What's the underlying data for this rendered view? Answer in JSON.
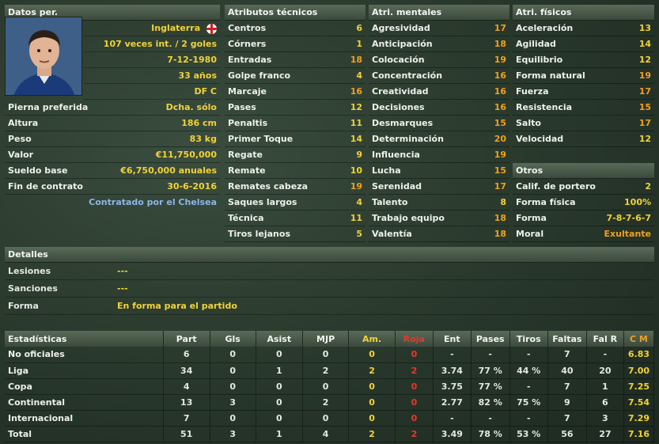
{
  "personal": {
    "header": "Datos per.",
    "nationality": "Inglaterra",
    "caps": "107 veces int. / 2 goles",
    "dob": "7-12-1980",
    "age": "33 años",
    "position": "DF C",
    "rows": [
      {
        "label": "Pierna preferida",
        "value": "Dcha. sólo"
      },
      {
        "label": "Altura",
        "value": "186 cm"
      },
      {
        "label": "Peso",
        "value": "83 kg"
      },
      {
        "label": "Valor",
        "value": "€11,750,000"
      },
      {
        "label": "Sueldo base",
        "value": "€6,750,000 anuales"
      },
      {
        "label": "Fin de contrato",
        "value": "30-6-2016"
      }
    ],
    "contract_note": "Contratado por el Chelsea"
  },
  "technical": {
    "header": "Atributos técnicos",
    "rows": [
      {
        "label": "Centros",
        "value": "6"
      },
      {
        "label": "Córners",
        "value": "1"
      },
      {
        "label": "Entradas",
        "value": "18"
      },
      {
        "label": "Golpe franco",
        "value": "4"
      },
      {
        "label": "Marcaje",
        "value": "16"
      },
      {
        "label": "Pases",
        "value": "12"
      },
      {
        "label": "Penaltis",
        "value": "11"
      },
      {
        "label": "Primer Toque",
        "value": "14"
      },
      {
        "label": "Regate",
        "value": "9"
      },
      {
        "label": "Remate",
        "value": "10"
      },
      {
        "label": "Remates cabeza",
        "value": "19"
      },
      {
        "label": "Saques largos",
        "value": "4"
      },
      {
        "label": "Técnica",
        "value": "11"
      },
      {
        "label": "Tiros lejanos",
        "value": "5"
      }
    ]
  },
  "mental": {
    "header": "Atri. mentales",
    "rows": [
      {
        "label": "Agresividad",
        "value": "17"
      },
      {
        "label": "Anticipación",
        "value": "18"
      },
      {
        "label": "Colocación",
        "value": "19"
      },
      {
        "label": "Concentración",
        "value": "16"
      },
      {
        "label": "Creatividad",
        "value": "16"
      },
      {
        "label": "Decisiones",
        "value": "16"
      },
      {
        "label": "Desmarques",
        "value": "15"
      },
      {
        "label": "Determinación",
        "value": "20"
      },
      {
        "label": "Influencia",
        "value": "19"
      },
      {
        "label": "Lucha",
        "value": "15"
      },
      {
        "label": "Serenidad",
        "value": "17"
      },
      {
        "label": "Talento",
        "value": "8"
      },
      {
        "label": "Trabajo equipo",
        "value": "18"
      },
      {
        "label": "Valentía",
        "value": "18"
      }
    ]
  },
  "physical": {
    "header": "Atri. físicos",
    "rows": [
      {
        "label": "Aceleración",
        "value": "13"
      },
      {
        "label": "Agilidad",
        "value": "14"
      },
      {
        "label": "Equilibrio",
        "value": "12"
      },
      {
        "label": "Forma natural",
        "value": "19"
      },
      {
        "label": "Fuerza",
        "value": "17"
      },
      {
        "label": "Resistencia",
        "value": "15"
      },
      {
        "label": "Salto",
        "value": "17"
      },
      {
        "label": "Velocidad",
        "value": "12"
      }
    ]
  },
  "otros": {
    "header": "Otros",
    "rows": [
      {
        "label": "Calif. de portero",
        "value": "2"
      },
      {
        "label": "Forma física",
        "value": "100%"
      },
      {
        "label": "Forma",
        "value": "7-8-7-6-7"
      },
      {
        "label": "Moral",
        "value": "Exultante"
      }
    ]
  },
  "detalles": {
    "header": "Detalles",
    "rows": [
      {
        "label": "Lesiones",
        "value": "---"
      },
      {
        "label": "Sanciones",
        "value": "---"
      },
      {
        "label": "Forma",
        "value": "En forma para el partido"
      }
    ]
  },
  "stats": {
    "headers": [
      "Estadísticas",
      "Part",
      "Gls",
      "Asist",
      "MJP",
      "Am.",
      "Roja",
      "Ent",
      "Pases",
      "Tiros",
      "Faltas",
      "Fal R",
      "C M"
    ],
    "rows": [
      [
        "No oficiales",
        "6",
        "0",
        "0",
        "0",
        "0",
        "0",
        "-",
        "-",
        "-",
        "7",
        "-",
        "6.83"
      ],
      [
        "Liga",
        "34",
        "0",
        "1",
        "2",
        "2",
        "2",
        "3.74",
        "77 %",
        "44 %",
        "40",
        "20",
        "7.00"
      ],
      [
        "Copa",
        "4",
        "0",
        "0",
        "0",
        "0",
        "0",
        "3.75",
        "77 %",
        "-",
        "7",
        "1",
        "7.25"
      ],
      [
        "Continental",
        "13",
        "3",
        "0",
        "2",
        "0",
        "0",
        "2.77",
        "82 %",
        "75 %",
        "9",
        "6",
        "7.54"
      ],
      [
        "Internacional",
        "7",
        "0",
        "0",
        "0",
        "0",
        "0",
        "-",
        "-",
        "-",
        "7",
        "3",
        "7.29"
      ],
      [
        "Total",
        "51",
        "3",
        "1",
        "4",
        "2",
        "2",
        "3.49",
        "78 %",
        "53 %",
        "56",
        "27",
        "7.16"
      ]
    ]
  },
  "colors": {
    "yellow": "#f2d23a",
    "orange": "#f0a020",
    "red": "#e33a2a",
    "blue": "#8fb4e8"
  }
}
